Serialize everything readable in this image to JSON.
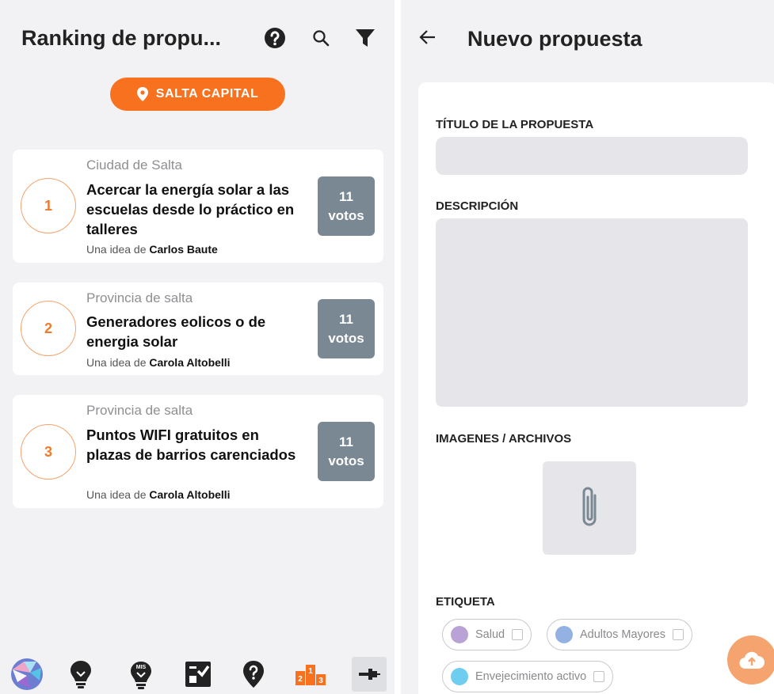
{
  "ranking": {
    "title": "Ranking de propu...",
    "location": "SALTA CAPITAL",
    "proposals": [
      {
        "rank": "1",
        "region": "Ciudad de Salta",
        "title": "Acercar la energía solar a las escuelas desde lo práctico en talleres",
        "author_prefix": "Una idea de",
        "author": "Carlos Baute",
        "votes_count": "11",
        "votes_label": "votos"
      },
      {
        "rank": "2",
        "region": "Provincia de salta",
        "title": "Generadores eolicos o de energia solar",
        "author_prefix": "Una idea de",
        "author": "Carola Altobelli",
        "votes_count": "11",
        "votes_label": "votos"
      },
      {
        "rank": "3",
        "region": "Provincia de salta",
        "title": "Puntos WIFI gratuitos en plazas de barrios carenciados",
        "author_prefix": "Una idea de",
        "author": "Carola Altobelli",
        "votes_count": "11",
        "votes_label": "votos"
      }
    ],
    "nav_icons": [
      "community-icon",
      "ideas-icon",
      "my-ideas-icon",
      "checklist-icon",
      "help-marker-icon",
      "ranking-icon",
      "pin-icon"
    ],
    "nav_podium_digits": [
      "2",
      "1",
      "3"
    ],
    "nav_badge_text": "MIS"
  },
  "new_proposal": {
    "title": "Nuevo propuesta",
    "labels": {
      "title_field": "TÍTULO DE LA PROPUESTA",
      "description": "DESCRIPCIÓN",
      "files": "IMAGENES / ARCHIVOS",
      "tags": "ETIQUETA"
    },
    "tags": [
      {
        "label": "Salud",
        "color": "#b9a3d6"
      },
      {
        "label": "Adultos Mayores",
        "color": "#93b1e2"
      },
      {
        "label": "Envejecimiento activo",
        "color": "#6fcdf0"
      }
    ]
  },
  "colors": {
    "accent": "#f7711f",
    "votes_bg": "#7a8894",
    "background": "#f2f2f4"
  }
}
